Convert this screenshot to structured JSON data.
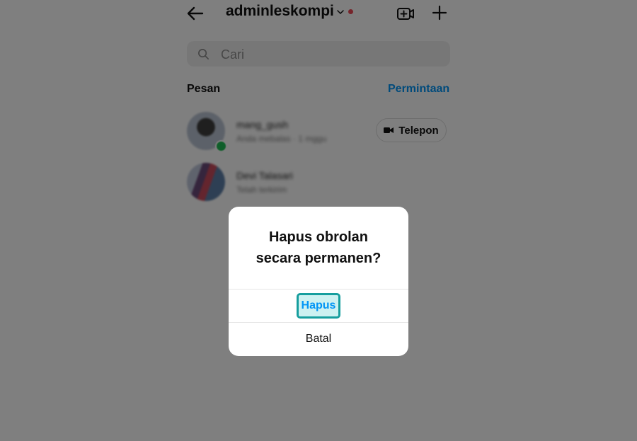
{
  "header": {
    "username": "adminleskompi",
    "icons": [
      "arrow-left-icon",
      "chevron-down-icon",
      "video-add-icon",
      "plus-icon"
    ],
    "notification_dot_color": "#ed4956"
  },
  "search": {
    "placeholder": "Cari",
    "value": ""
  },
  "messages": {
    "section_title": "Pesan",
    "requests_label": "Permintaan",
    "conversations": [
      {
        "name": "mang_gush",
        "subtitle": "Anda mebalas · 1 mggu",
        "online": true,
        "action_label": "Telepon"
      },
      {
        "name": "Devi Talasari",
        "subtitle": "Telah terkirim",
        "online": false
      }
    ]
  },
  "dialog": {
    "title_line1": "Hapus obrolan",
    "title_line2": "secara permanen?",
    "confirm_label": "Hapus",
    "cancel_label": "Batal"
  },
  "colors": {
    "accent": "#0095f6",
    "highlight_border": "#169e9e",
    "online": "#1fbd54"
  }
}
